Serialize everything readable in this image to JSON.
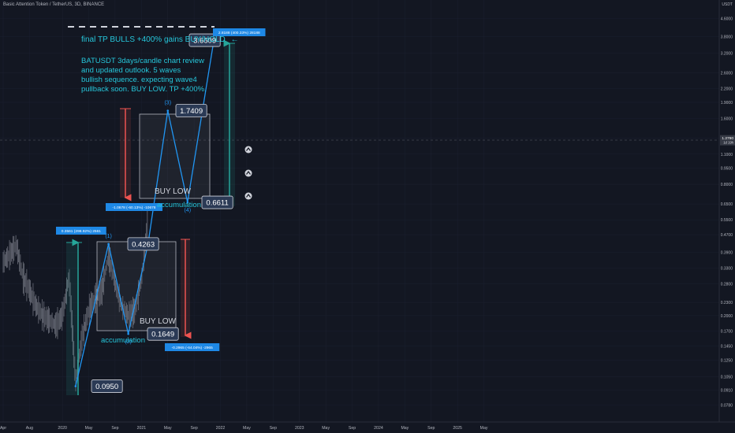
{
  "header": {
    "title": "Basic Attention Token / TetherUS, 3D, BINANCE"
  },
  "annotations": {
    "headline": "final TP BULLS +400% gains BUY/HOLD",
    "arrow": "←",
    "description": [
      "BATUSDT 3days/candle chart review",
      "and updated outlook. 5 waves",
      "bullish sequence. expecting wave4",
      "pullback soon. BUY LOW. TP +400%."
    ],
    "buy_low_upper": "BUY LOW",
    "buy_low_lower": "BUY LOW",
    "accumulation_upper": "accumulation",
    "accumulation_lower": "accumulation",
    "wave_labels": [
      "(1)",
      "(2)",
      "(3)",
      "(4)"
    ]
  },
  "price_labels": [
    "3.6609",
    "1.7409",
    "0.6611",
    "0.4263",
    "0.1649",
    "0.0950"
  ],
  "measure_labels": {
    "m1": "0.3561 (298.92%) 2561",
    "m2": "-1.0678 (-60.13%) -10678",
    "m3": "-0.2965 (-64.04%) -2965",
    "m4": "2.8188 (400.33%) 28188"
  },
  "price_axis": {
    "currency": "USDT",
    "ticks": [
      "4.6000",
      "3.8000",
      "3.2000",
      "2.6000",
      "2.2000",
      "1.9000",
      "1.6000",
      "1.3000",
      "1.1000",
      "0.9500",
      "0.8000",
      "0.6500",
      "0.5500",
      "0.4700",
      "0.3900",
      "0.3300",
      "0.2800",
      "0.2300",
      "0.2000",
      "0.1700",
      "0.1450",
      "0.1250",
      "0.1050",
      "0.0910",
      "0.0780"
    ],
    "current_price": "1.2790",
    "countdown": "1d 19h"
  },
  "time_axis": {
    "ticks": [
      "Apr",
      "Aug",
      "2020",
      "May",
      "Sep",
      "2021",
      "May",
      "Sep",
      "2022",
      "May",
      "Sep",
      "2023",
      "May",
      "Sep",
      "2024",
      "May",
      "Sep",
      "2025",
      "May"
    ]
  },
  "chart_data": {
    "type": "line",
    "title": "Basic Attention Token / TetherUS, 3D, BINANCE",
    "y_scale": "log",
    "ylim": [
      0.075,
      4.7
    ],
    "xlim": [
      "2019-03",
      "2025-06"
    ],
    "series": [
      {
        "name": "",
        "x": [
          "2019-04",
          "2019-05",
          "2019-06",
          "2019-07",
          "2019-08",
          "2019-09",
          "2019-10",
          "2019-11",
          "2019-12",
          "2020-01",
          "2020-02",
          "2020-03",
          "2020-04",
          "2020-05",
          "2020-06",
          "2020-07",
          "2020-08",
          "2020-09",
          "2020-10",
          "2020-11",
          "2020-12",
          "2021-01",
          "2021-02"
        ],
        "values": [
          0.35,
          0.38,
          0.42,
          0.3,
          0.26,
          0.22,
          0.2,
          0.19,
          0.18,
          0.2,
          0.3,
          0.1,
          0.16,
          0.21,
          0.24,
          0.26,
          0.38,
          0.28,
          0.22,
          0.2,
          0.21,
          0.29,
          0.55
        ]
      },
      {
        "name": "",
        "x": [
          "2020-03",
          "2020-08",
          "2020-11",
          "2021-02",
          "2021-05",
          "2021-08",
          "2021-12"
        ],
        "values": [
          0.095,
          0.4263,
          0.1649,
          0.4263,
          1.7409,
          0.6611,
          3.6609
        ]
      }
    ],
    "annotations": [
      "(1)",
      "(2)",
      "(3)",
      "(4)",
      "final TP BULLS +400% gains BUY/HOLD"
    ]
  },
  "colors": {
    "background": "#131722",
    "accent": "#26c6da",
    "projection": "#2196f3",
    "axis_text": "#b2b5be",
    "label_box": "#2b3a55",
    "measure_box": "#1e88e5",
    "range_green": "#26a69a",
    "range_red": "#ef5350",
    "candles": "#787b86",
    "grid": "#1c2030"
  }
}
